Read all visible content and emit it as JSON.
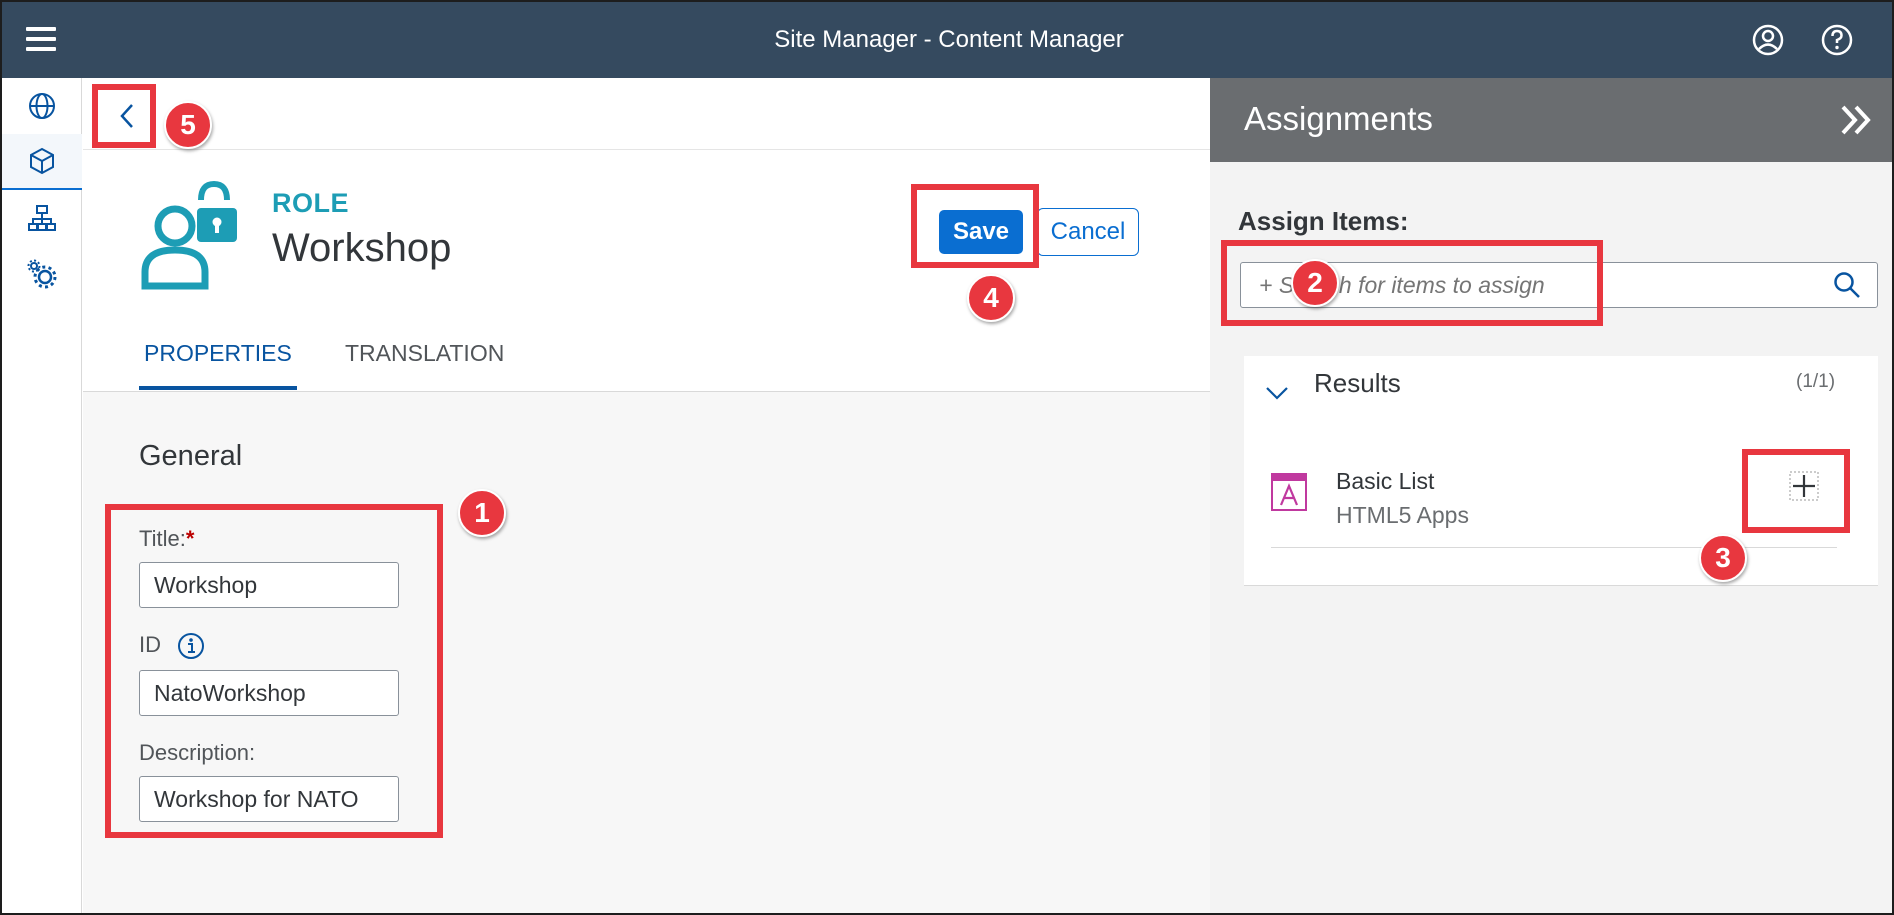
{
  "shellbar": {
    "title": "Site Manager - Content Manager",
    "icons": {
      "menu": "hamburger-menu-icon",
      "user": "user-profile-icon",
      "help": "help-icon"
    }
  },
  "sidenav": {
    "items": [
      {
        "icon": "globe-icon",
        "active": false
      },
      {
        "icon": "content-cube-icon",
        "active": true
      },
      {
        "icon": "hierarchy-icon",
        "active": false
      },
      {
        "icon": "settings-gears-icon",
        "active": false
      }
    ]
  },
  "header": {
    "object_type": "ROLE",
    "object_title": "Workshop",
    "save_label": "Save",
    "cancel_label": "Cancel",
    "tabs": [
      {
        "label": "PROPERTIES",
        "active": true
      },
      {
        "label": "TRANSLATION",
        "active": false
      }
    ]
  },
  "form": {
    "section_title": "General",
    "title_label": "Title:",
    "required_marker": "*",
    "title_value": "Workshop",
    "id_label": "ID",
    "id_value": "NatoWorkshop",
    "description_label": "Description:",
    "description_value": "Workshop for NATO"
  },
  "assignments": {
    "panel_title": "Assignments",
    "assign_label": "Assign Items:",
    "search_placeholder": "+ Search for items to assign",
    "results_title": "Results",
    "results_count": "(1/1)",
    "items": [
      {
        "title": "Basic List",
        "subtitle": "HTML5 Apps"
      }
    ]
  },
  "callouts": [
    "1",
    "2",
    "3",
    "4",
    "5"
  ],
  "colors": {
    "shellbar_bg": "#354a5f",
    "accent_blue": "#0a6ed1",
    "role_teal": "#1d9db5",
    "panel_header_bg": "#6a6d70",
    "callout_red": "#e8373f",
    "app_icon_magenta": "#c0399f"
  }
}
